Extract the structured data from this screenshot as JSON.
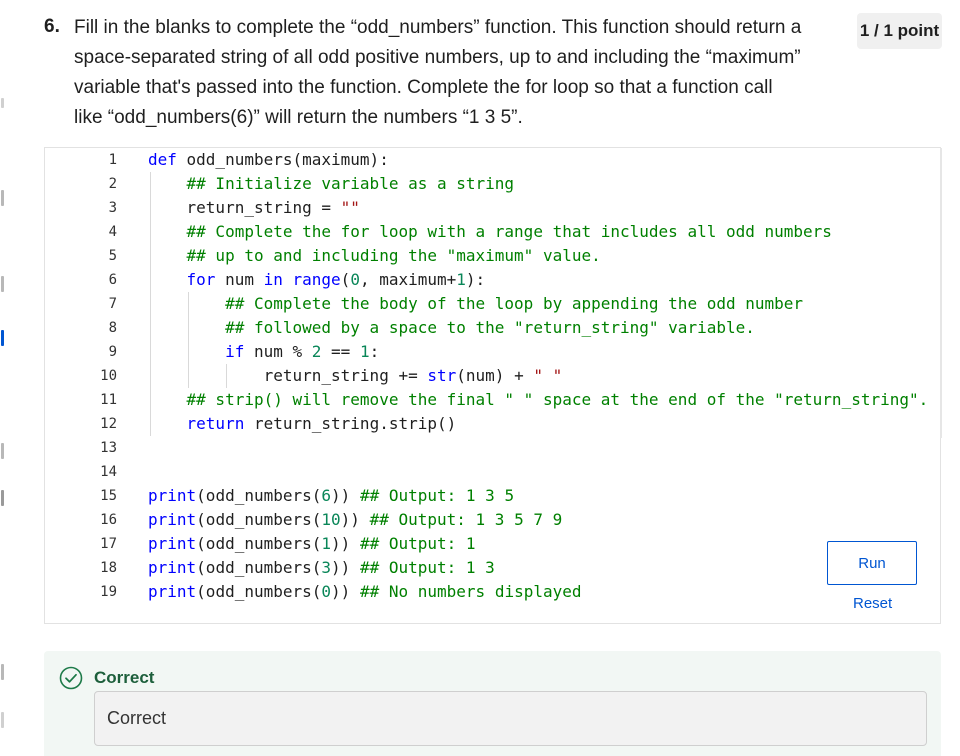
{
  "question": {
    "number": "6.",
    "text": "Fill in the blanks to complete the “odd_numbers” function. This function should return a space-separated string of all odd positive numbers, up to and including the “maximum” variable that's passed into the function. Complete the for loop so that a function call like “odd_numbers(6)” will return the numbers “1 3 5”.",
    "points": "1 / 1 point"
  },
  "editor": {
    "line_numbers": [
      "1",
      "2",
      "3",
      "4",
      "5",
      "6",
      "7",
      "8",
      "9",
      "10",
      "11",
      "12",
      "13",
      "14",
      "15",
      "16",
      "17",
      "18",
      "19"
    ],
    "lines": [
      [
        {
          "t": "def ",
          "c": "kw"
        },
        {
          "t": "odd_numbers(maximum):",
          "c": "pl"
        }
      ],
      [
        {
          "t": "    ## Initialize variable as a string",
          "c": "cm"
        }
      ],
      [
        {
          "t": "    return_string = ",
          "c": "pl"
        },
        {
          "t": "\"\"",
          "c": "st"
        }
      ],
      [
        {
          "t": "    ## Complete the for loop with a range that includes all odd numbers",
          "c": "cm"
        }
      ],
      [
        {
          "t": "    ## up to and including the \"maximum\" value.",
          "c": "cm"
        }
      ],
      [
        {
          "t": "    ",
          "c": "pl"
        },
        {
          "t": "for ",
          "c": "kw"
        },
        {
          "t": "num ",
          "c": "pl"
        },
        {
          "t": "in ",
          "c": "kw"
        },
        {
          "t": "range",
          "c": "bi"
        },
        {
          "t": "(",
          "c": "pl"
        },
        {
          "t": "0",
          "c": "nm"
        },
        {
          "t": ", maximum+",
          "c": "pl"
        },
        {
          "t": "1",
          "c": "nm"
        },
        {
          "t": "):",
          "c": "pl"
        }
      ],
      [
        {
          "t": "        ## Complete the body of the loop by appending the odd number",
          "c": "cm"
        }
      ],
      [
        {
          "t": "        ## followed by a space to the \"return_string\" variable.",
          "c": "cm"
        }
      ],
      [
        {
          "t": "        ",
          "c": "pl"
        },
        {
          "t": "if ",
          "c": "kw"
        },
        {
          "t": "num % ",
          "c": "pl"
        },
        {
          "t": "2",
          "c": "nm"
        },
        {
          "t": " == ",
          "c": "pl"
        },
        {
          "t": "1",
          "c": "nm"
        },
        {
          "t": ":",
          "c": "pl"
        }
      ],
      [
        {
          "t": "            return_string += ",
          "c": "pl"
        },
        {
          "t": "str",
          "c": "bi"
        },
        {
          "t": "(num) + ",
          "c": "pl"
        },
        {
          "t": "\" \"",
          "c": "st"
        }
      ],
      [
        {
          "t": "    ## strip() will remove the final \" \" space at the end of the \"return_string\".",
          "c": "cm"
        }
      ],
      [
        {
          "t": "    ",
          "c": "pl"
        },
        {
          "t": "return ",
          "c": "kw"
        },
        {
          "t": "return_string.strip()",
          "c": "pl"
        }
      ],
      [],
      [],
      [
        {
          "t": "print",
          "c": "bi"
        },
        {
          "t": "(odd_numbers(",
          "c": "pl"
        },
        {
          "t": "6",
          "c": "nm"
        },
        {
          "t": ")) ",
          "c": "pl"
        },
        {
          "t": "## Output: 1 3 5",
          "c": "cm"
        }
      ],
      [
        {
          "t": "print",
          "c": "bi"
        },
        {
          "t": "(odd_numbers(",
          "c": "pl"
        },
        {
          "t": "10",
          "c": "nm"
        },
        {
          "t": ")) ",
          "c": "pl"
        },
        {
          "t": "## Output: 1 3 5 7 9",
          "c": "cm"
        }
      ],
      [
        {
          "t": "print",
          "c": "bi"
        },
        {
          "t": "(odd_numbers(",
          "c": "pl"
        },
        {
          "t": "1",
          "c": "nm"
        },
        {
          "t": ")) ",
          "c": "pl"
        },
        {
          "t": "## Output: 1",
          "c": "cm"
        }
      ],
      [
        {
          "t": "print",
          "c": "bi"
        },
        {
          "t": "(odd_numbers(",
          "c": "pl"
        },
        {
          "t": "3",
          "c": "nm"
        },
        {
          "t": ")) ",
          "c": "pl"
        },
        {
          "t": "## Output: 1 3",
          "c": "cm"
        }
      ],
      [
        {
          "t": "print",
          "c": "bi"
        },
        {
          "t": "(odd_numbers(",
          "c": "pl"
        },
        {
          "t": "0",
          "c": "nm"
        },
        {
          "t": ")) ",
          "c": "pl"
        },
        {
          "t": "## No numbers displayed",
          "c": "cm"
        }
      ]
    ],
    "run_label": "Run",
    "reset_label": "Reset"
  },
  "feedback": {
    "status": "Correct",
    "message": "Correct",
    "icon": "check-circle-icon"
  },
  "colors": {
    "accent": "#0056d2",
    "success": "#1d5f3b",
    "keyword": "#0000ff",
    "comment": "#008000",
    "string": "#a31515",
    "number": "#098658"
  }
}
